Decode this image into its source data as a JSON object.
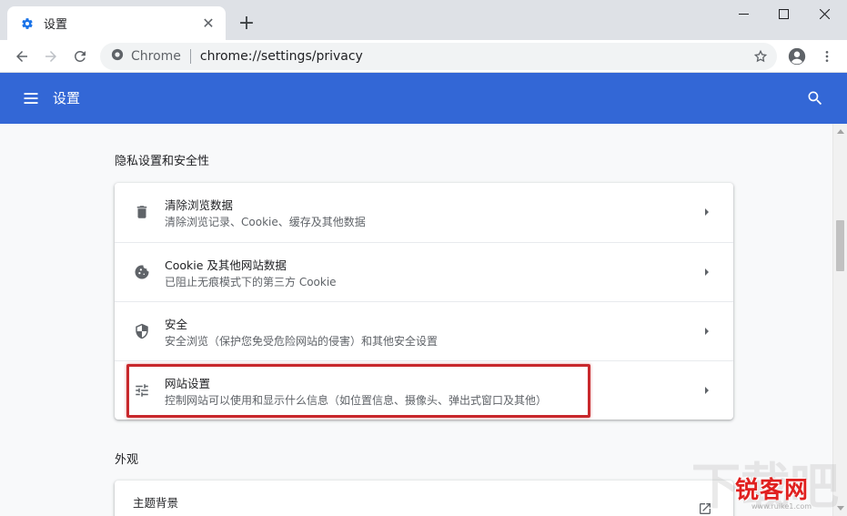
{
  "tab": {
    "title": "设置",
    "close_glyph": "✕",
    "new_tab_glyph": "+"
  },
  "omnibox": {
    "site_label": "Chrome",
    "url": "chrome://settings/privacy"
  },
  "header": {
    "title": "设置"
  },
  "privacy_section": {
    "title": "隐私设置和安全性",
    "items": [
      {
        "title": "清除浏览数据",
        "subtitle": "清除浏览记录、Cookie、缓存及其他数据",
        "icon": "trash-icon"
      },
      {
        "title": "Cookie 及其他网站数据",
        "subtitle": "已阻止无痕模式下的第三方 Cookie",
        "icon": "cookie-icon"
      },
      {
        "title": "安全",
        "subtitle": "安全浏览（保护您免受危险网站的侵害）和其他安全设置",
        "icon": "shield-icon"
      },
      {
        "title": "网站设置",
        "subtitle": "控制网站可以使用和显示什么信息（如位置信息、摄像头、弹出式窗口及其他）",
        "icon": "tune-icon"
      }
    ]
  },
  "appearance_section": {
    "title": "外观",
    "items": [
      {
        "title": "主题背景",
        "icon": "open-in-new-icon"
      }
    ]
  },
  "watermark": {
    "brand": "锐客网",
    "domain": "www.ruike1.com",
    "faint": "下载吧"
  },
  "colors": {
    "header_bg": "#3367d6",
    "highlight_border": "#c8282c",
    "icon_gray": "#5f6368"
  }
}
